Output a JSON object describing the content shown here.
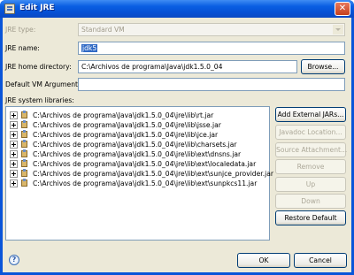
{
  "window": {
    "title": "Edit JRE",
    "close_glyph": "✕"
  },
  "form": {
    "jre_type_label": "JRE type:",
    "jre_type_value": "Standard VM",
    "jre_name_label": "JRE name:",
    "jre_name_value": "jdk5",
    "jre_home_label": "JRE home directory:",
    "jre_home_value": "C:\\Archivos de programa\\Java\\jdk1.5.0_04",
    "browse_label": "Browse...",
    "vm_args_label": "Default VM Arguments:",
    "vm_args_value": "",
    "libraries_label": "JRE system libraries:"
  },
  "libraries": [
    "C:\\Archivos de programa\\Java\\jdk1.5.0_04\\jre\\lib\\rt.jar",
    "C:\\Archivos de programa\\Java\\jdk1.5.0_04\\jre\\lib\\jsse.jar",
    "C:\\Archivos de programa\\Java\\jdk1.5.0_04\\jre\\lib\\jce.jar",
    "C:\\Archivos de programa\\Java\\jdk1.5.0_04\\jre\\lib\\charsets.jar",
    "C:\\Archivos de programa\\Java\\jdk1.5.0_04\\jre\\lib\\ext\\dnsns.jar",
    "C:\\Archivos de programa\\Java\\jdk1.5.0_04\\jre\\lib\\ext\\localedata.jar",
    "C:\\Archivos de programa\\Java\\jdk1.5.0_04\\jre\\lib\\ext\\sunjce_provider.jar",
    "C:\\Archivos de programa\\Java\\jdk1.5.0_04\\jre\\lib\\ext\\sunpkcs11.jar"
  ],
  "side_buttons": {
    "add_external": "Add External JARs...",
    "javadoc": "Javadoc Location...",
    "source": "Source Attachment...",
    "remove": "Remove",
    "up": "Up",
    "down": "Down",
    "restore": "Restore Default"
  },
  "footer": {
    "help_glyph": "?",
    "ok": "OK",
    "cancel": "Cancel"
  },
  "colors": {
    "titlebar": "#0a5fe3",
    "dialog_bg": "#ece9d8",
    "selection": "#316ac5"
  }
}
